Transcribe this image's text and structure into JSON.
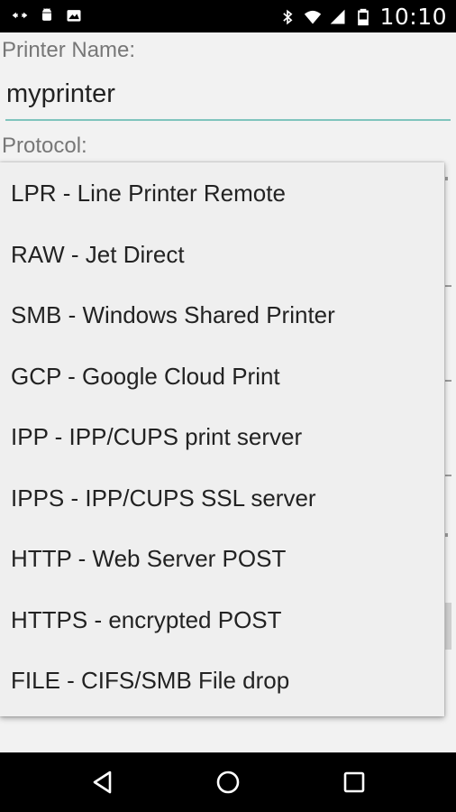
{
  "status_bar": {
    "time": "10:10",
    "left_icons": [
      "usb-debug-icon",
      "android-icon",
      "image-notification-icon"
    ],
    "right_icons": [
      "bluetooth-icon",
      "wifi-icon",
      "cell-signal-icon",
      "battery-icon"
    ]
  },
  "form": {
    "printer_name_label": "Printer Name:",
    "printer_name_value": "myprinter",
    "protocol_label": "Protocol:"
  },
  "dropdown": {
    "options": [
      "LPR - Line Printer Remote",
      "RAW - Jet Direct",
      "SMB - Windows Shared Printer",
      "GCP - Google Cloud Print",
      "IPP - IPP/CUPS print server",
      "IPPS - IPP/CUPS SSL server",
      "HTTP - Web Server POST",
      "HTTPS - encrypted POST",
      "FILE - CIFS/SMB File drop"
    ]
  },
  "nav_bar": {
    "buttons": [
      "back-icon",
      "home-icon",
      "recents-icon"
    ]
  }
}
